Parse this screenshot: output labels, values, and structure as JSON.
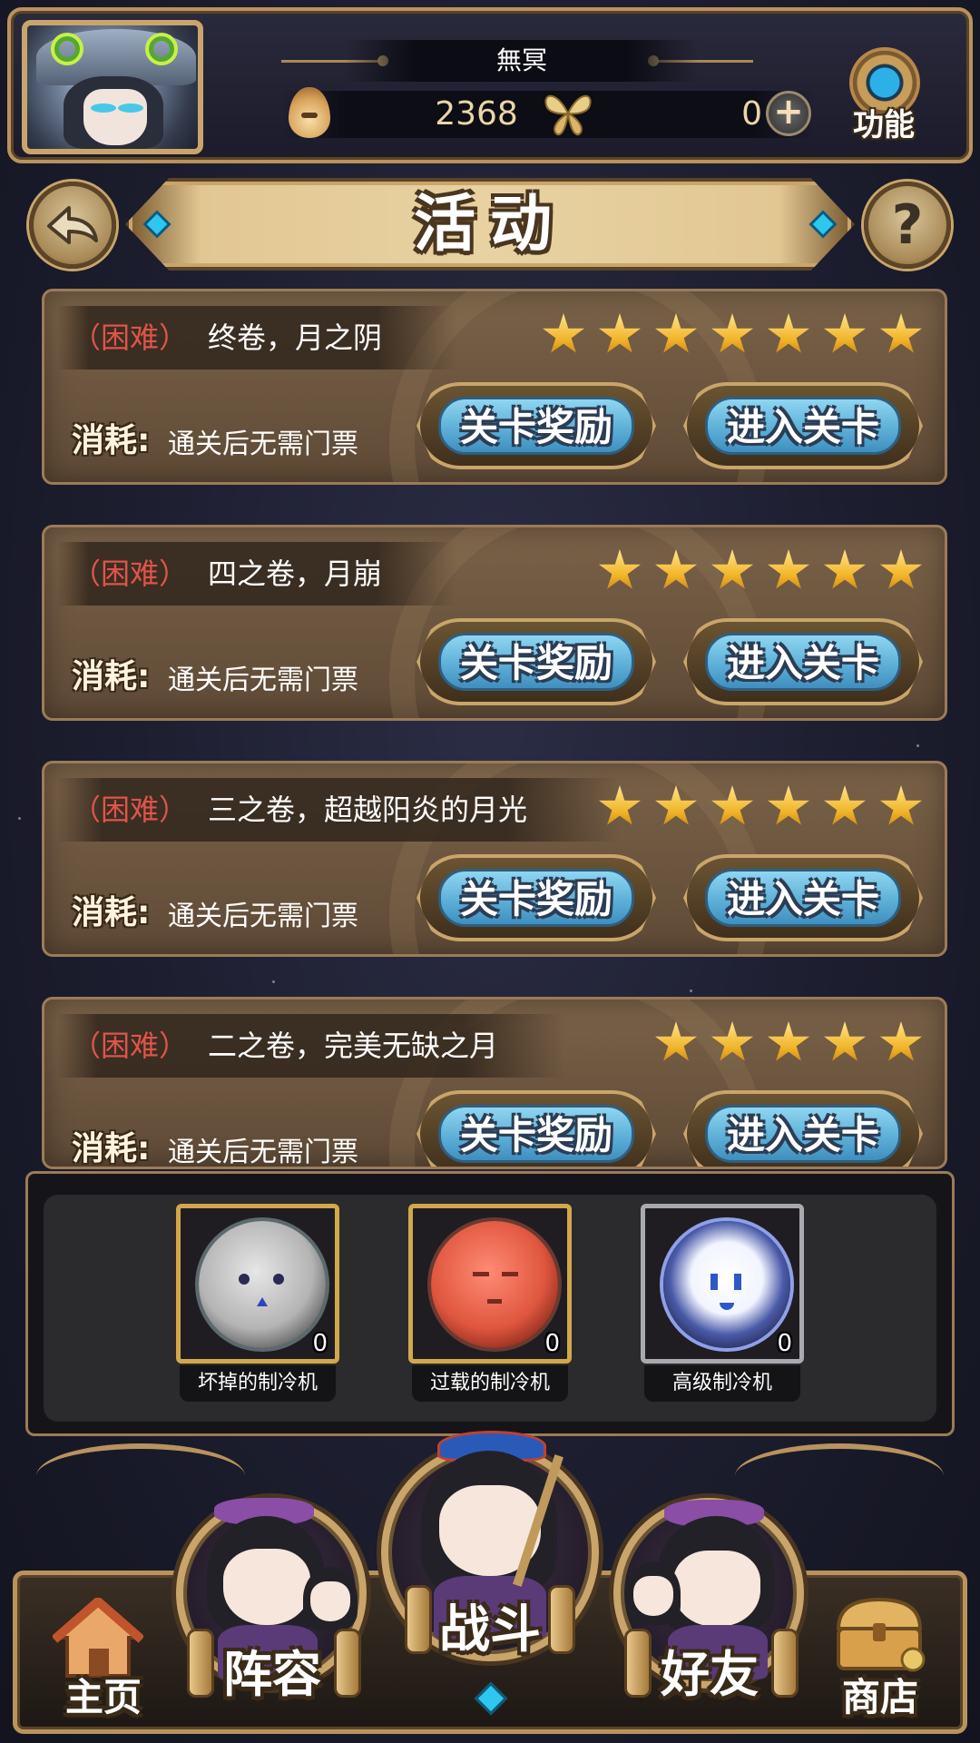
{
  "header": {
    "player_name": "無冥",
    "money_value": "2368",
    "gem_value": "0",
    "plus_label": "+",
    "function_label": "功能"
  },
  "title_bar": {
    "title": "活动",
    "back_icon": "back-arrow-icon",
    "help_label": "?"
  },
  "stages": [
    {
      "difficulty": "（困难）",
      "name": "终卷，月之阴",
      "stars": 7,
      "cost_label": "消耗:",
      "cost_value": "通关后无需门票",
      "reward_button": "关卡奖励",
      "enter_button": "进入关卡"
    },
    {
      "difficulty": "（困难）",
      "name": "四之卷，月崩",
      "stars": 6,
      "cost_label": "消耗:",
      "cost_value": "通关后无需门票",
      "reward_button": "关卡奖励",
      "enter_button": "进入关卡"
    },
    {
      "difficulty": "（困难）",
      "name": "三之卷，超越阳炎的月光",
      "stars": 6,
      "cost_label": "消耗:",
      "cost_value": "通关后无需门票",
      "reward_button": "关卡奖励",
      "enter_button": "进入关卡"
    },
    {
      "difficulty": "（困难）",
      "name": "二之卷，完美无缺之月",
      "stars": 5,
      "cost_label": "消耗:",
      "cost_value": "通关后无需门票",
      "reward_button": "关卡奖励",
      "enter_button": "进入关卡"
    }
  ],
  "items": [
    {
      "name": "坏掉的制冷机",
      "count": "0",
      "icon": "broken-cooler-icon",
      "frame": "gold"
    },
    {
      "name": "过载的制冷机",
      "count": "0",
      "icon": "overloaded-cooler-icon",
      "frame": "gold"
    },
    {
      "name": "高级制冷机",
      "count": "0",
      "icon": "advanced-cooler-icon",
      "frame": "silver"
    }
  ],
  "nav": {
    "home": "主页",
    "team": "阵容",
    "battle": "战斗",
    "friends": "好友",
    "shop": "商店"
  },
  "colors": {
    "gold": "#c9a56b",
    "difficulty_red": "#e0544a",
    "button_blue": "#5eb0d8",
    "star_yellow": "#f1b52a"
  }
}
